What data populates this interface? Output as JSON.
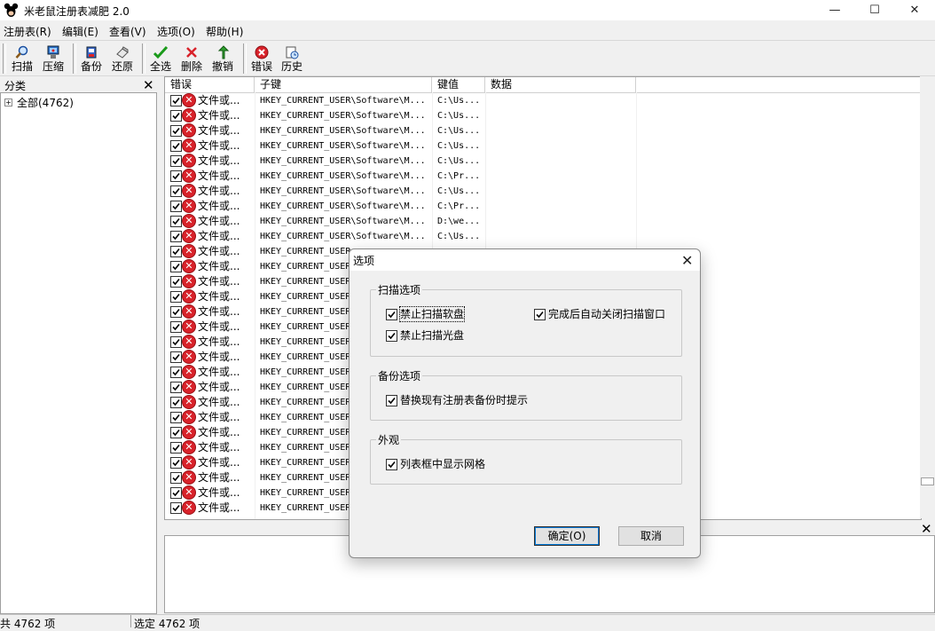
{
  "window": {
    "title": "米老鼠注册表减肥 2.0",
    "controls": {
      "minimize": "—",
      "maximize": "☐",
      "close": "✕"
    }
  },
  "menu": [
    "注册表(R)",
    "编辑(E)",
    "查看(V)",
    "选项(O)",
    "帮助(H)"
  ],
  "toolbar": {
    "scan": "扫描",
    "compress": "压缩",
    "backup": "备份",
    "restore": "还原",
    "select_all": "全选",
    "delete": "删除",
    "undo": "撤销",
    "errors": "错误",
    "history": "历史"
  },
  "left_pane": {
    "title": "分类",
    "close": "✕",
    "tree_root": "全部(4762)",
    "expander": "+"
  },
  "list": {
    "columns": [
      "错误",
      "子键",
      "键值",
      "数据"
    ],
    "rows": [
      {
        "error": "文件或...",
        "subkey": "HKEY_CURRENT_USER\\Software\\M...",
        "value": "C:\\Us..."
      },
      {
        "error": "文件或...",
        "subkey": "HKEY_CURRENT_USER\\Software\\M...",
        "value": "C:\\Us..."
      },
      {
        "error": "文件或...",
        "subkey": "HKEY_CURRENT_USER\\Software\\M...",
        "value": "C:\\Us..."
      },
      {
        "error": "文件或...",
        "subkey": "HKEY_CURRENT_USER\\Software\\M...",
        "value": "C:\\Us..."
      },
      {
        "error": "文件或...",
        "subkey": "HKEY_CURRENT_USER\\Software\\M...",
        "value": "C:\\Us..."
      },
      {
        "error": "文件或...",
        "subkey": "HKEY_CURRENT_USER\\Software\\M...",
        "value": "C:\\Pr..."
      },
      {
        "error": "文件或...",
        "subkey": "HKEY_CURRENT_USER\\Software\\M...",
        "value": "C:\\Us..."
      },
      {
        "error": "文件或...",
        "subkey": "HKEY_CURRENT_USER\\Software\\M...",
        "value": "C:\\Pr..."
      },
      {
        "error": "文件或...",
        "subkey": "HKEY_CURRENT_USER\\Software\\M...",
        "value": "D:\\we..."
      },
      {
        "error": "文件或...",
        "subkey": "HKEY_CURRENT_USER\\Software\\M...",
        "value": "C:\\Us..."
      },
      {
        "error": "文件或...",
        "subkey": "HKEY_CURRENT_USER",
        "value": ""
      },
      {
        "error": "文件或...",
        "subkey": "HKEY_CURRENT_USER",
        "value": ""
      },
      {
        "error": "文件或...",
        "subkey": "HKEY_CURRENT_USER",
        "value": ""
      },
      {
        "error": "文件或...",
        "subkey": "HKEY_CURRENT_USER",
        "value": ""
      },
      {
        "error": "文件或...",
        "subkey": "HKEY_CURRENT_USER",
        "value": ""
      },
      {
        "error": "文件或...",
        "subkey": "HKEY_CURRENT_USER",
        "value": ""
      },
      {
        "error": "文件或...",
        "subkey": "HKEY_CURRENT_USER",
        "value": ""
      },
      {
        "error": "文件或...",
        "subkey": "HKEY_CURRENT_USER",
        "value": ""
      },
      {
        "error": "文件或...",
        "subkey": "HKEY_CURRENT_USER",
        "value": ""
      },
      {
        "error": "文件或...",
        "subkey": "HKEY_CURRENT_USER",
        "value": ""
      },
      {
        "error": "文件或...",
        "subkey": "HKEY_CURRENT_USER",
        "value": ""
      },
      {
        "error": "文件或...",
        "subkey": "HKEY_CURRENT_USER",
        "value": ""
      },
      {
        "error": "文件或...",
        "subkey": "HKEY_CURRENT_USER",
        "value": ""
      },
      {
        "error": "文件或...",
        "subkey": "HKEY_CURRENT_USER",
        "value": ""
      },
      {
        "error": "文件或...",
        "subkey": "HKEY_CURRENT_USER",
        "value": ""
      },
      {
        "error": "文件或...",
        "subkey": "HKEY_CURRENT_USER",
        "value": ""
      },
      {
        "error": "文件或...",
        "subkey": "HKEY_CURRENT_USER",
        "value": ""
      },
      {
        "error": "文件或...",
        "subkey": "HKEY_CURRENT_USER",
        "value": ""
      }
    ]
  },
  "lower_pane": {
    "close": "✕"
  },
  "status": {
    "total": "共 4762 项",
    "selected": "选定 4762 项"
  },
  "dialog": {
    "title": "选项",
    "close": "✕",
    "scan_group": {
      "label": "扫描选项",
      "no_floppy": "禁止扫描软盘",
      "no_cdrom": "禁止扫描光盘",
      "auto_close": "完成后自动关闭扫描窗口"
    },
    "backup_group": {
      "label": "备份选项",
      "prompt_replace": "替换现有注册表备份时提示"
    },
    "appearance_group": {
      "label": "外观",
      "show_grid": "列表框中显示网格"
    },
    "ok": "确定(O)",
    "cancel": "取消"
  },
  "colors": {
    "error_red": "#d8222a",
    "focus_blue": "#0078d7",
    "window_bg": "#f0f0f0"
  },
  "icons": {
    "error": "error-x-icon",
    "checkbox": "checkmark-icon"
  }
}
